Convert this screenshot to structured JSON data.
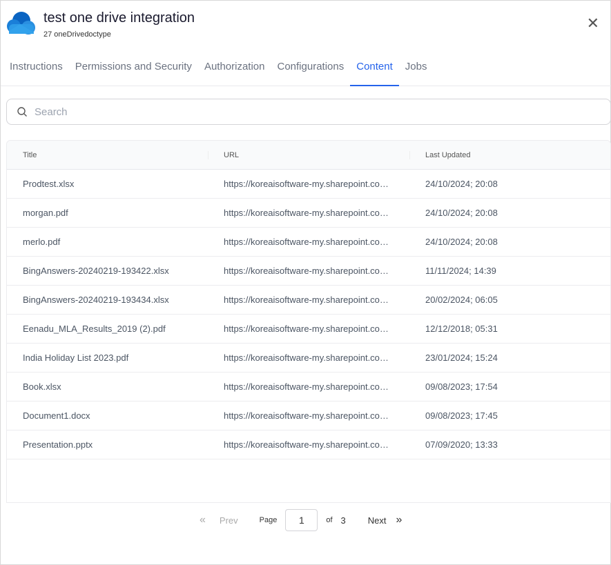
{
  "header": {
    "title": "test one drive integration",
    "subtitle": "27 oneDrivedoctype",
    "close_icon": "close-icon"
  },
  "tabs": [
    {
      "label": "Instructions"
    },
    {
      "label": "Permissions and Security"
    },
    {
      "label": "Authorization"
    },
    {
      "label": "Configurations"
    },
    {
      "label": "Content",
      "active": true
    },
    {
      "label": "Jobs"
    }
  ],
  "search": {
    "placeholder": "Search",
    "value": ""
  },
  "table": {
    "columns": [
      "Title",
      "URL",
      "Last Updated"
    ],
    "rows": [
      [
        "Prodtest.xlsx",
        "https://koreaisoftware-my.sharepoint.com/...",
        "24/10/2024; 20:08"
      ],
      [
        "morgan.pdf",
        "https://koreaisoftware-my.sharepoint.com/...",
        "24/10/2024; 20:08"
      ],
      [
        "merlo.pdf",
        "https://koreaisoftware-my.sharepoint.com/...",
        "24/10/2024; 20:08"
      ],
      [
        "BingAnswers-20240219-193422.xlsx",
        "https://koreaisoftware-my.sharepoint.com/...",
        "11/11/2024; 14:39"
      ],
      [
        "BingAnswers-20240219-193434.xlsx",
        "https://koreaisoftware-my.sharepoint.com/...",
        "20/02/2024; 06:05"
      ],
      [
        "Eenadu_MLA_Results_2019 (2).pdf",
        "https://koreaisoftware-my.sharepoint.com/...",
        "12/12/2018; 05:31"
      ],
      [
        "India Holiday List 2023.pdf",
        "https://koreaisoftware-my.sharepoint.com/...",
        "23/01/2024; 15:24"
      ],
      [
        "Book.xlsx",
        "https://koreaisoftware-my.sharepoint.com/...",
        "09/08/2023; 17:54"
      ],
      [
        "Document1.docx",
        "https://koreaisoftware-my.sharepoint.com/...",
        "09/08/2023; 17:45"
      ],
      [
        "Presentation.pptx",
        "https://koreaisoftware-my.sharepoint.com/...",
        "07/09/2020; 13:33"
      ]
    ]
  },
  "pagination": {
    "first": "«",
    "prev": "Prev",
    "page_label": "Page",
    "current": "1",
    "of_label": "of",
    "total": "3",
    "next": "Next",
    "last": "»"
  }
}
